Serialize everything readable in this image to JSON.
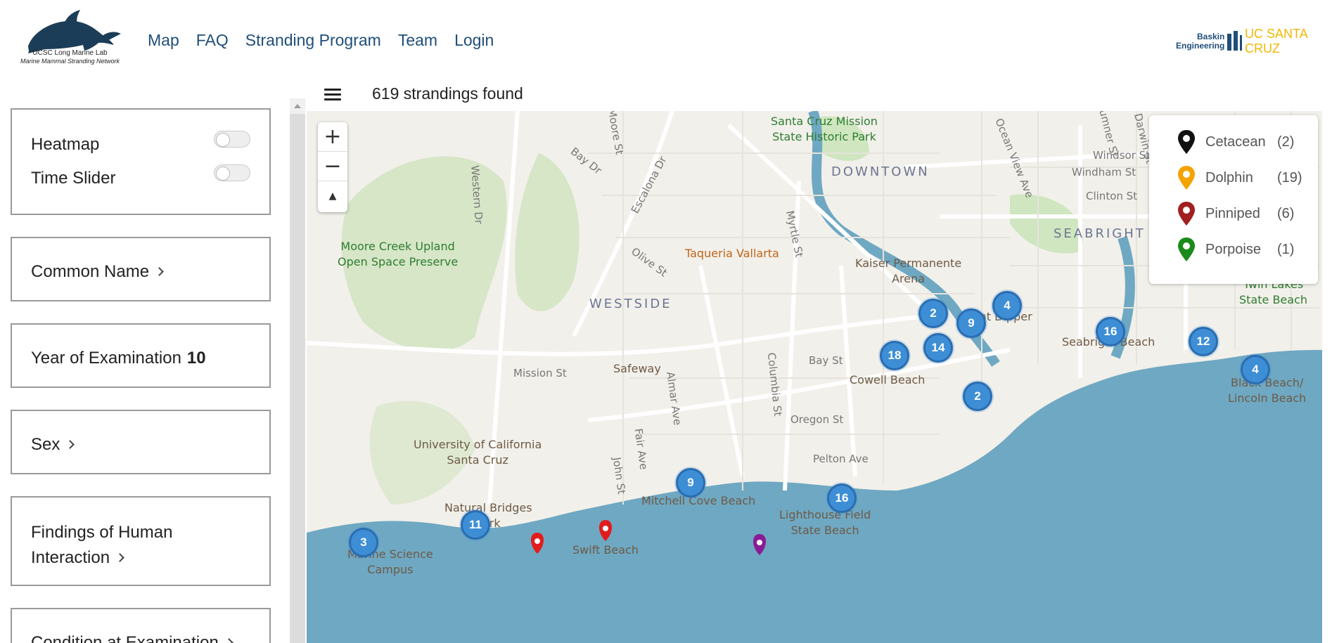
{
  "header": {
    "logo_line1": "UCSC Long Marine Lab",
    "logo_line2": "Marine Mammal Stranding Network",
    "nav": [
      "Map",
      "FAQ",
      "Stranding Program",
      "Team",
      "Login"
    ],
    "brand_baskin_line1": "Baskin",
    "brand_baskin_line2": "Engineering",
    "brand_ucsc": "UC SANTA CRUZ"
  },
  "toolbar": {
    "count_text": "619 strandings found"
  },
  "sidebar": {
    "heatmap_label": "Heatmap",
    "time_slider_label": "Time Slider",
    "common_name_label": "Common Name",
    "year_label": "Year of Examination",
    "year_count": "10",
    "sex_label": "Sex",
    "findings_label_line1": "Findings of Human",
    "findings_label_line2": "Interaction",
    "condition_label": "Condition at Examination"
  },
  "map": {
    "zoom_in": "+",
    "zoom_out": "−",
    "reset": "▲",
    "legend": [
      {
        "name": "Cetacean",
        "count": "(2)",
        "color": "#111111"
      },
      {
        "name": "Dolphin",
        "count": "(19)",
        "color": "#f5a300"
      },
      {
        "name": "Pinniped",
        "count": "(6)",
        "color": "#a11f1f"
      },
      {
        "name": "Porpoise",
        "count": "(1)",
        "color": "#1b8a1b"
      }
    ],
    "clusters": [
      "3",
      "11",
      "9",
      "16",
      "18",
      "2",
      "14",
      "9",
      "4",
      "2",
      "16",
      "12",
      "4"
    ],
    "labels": {
      "mission": "Santa Cruz Mission",
      "mission2": "State Historic Park",
      "downtown": "DOWNTOWN",
      "seabright": "SEABRIGHT",
      "westside": "WESTSIDE",
      "moore1": "Moore Creek Upland",
      "moore2": "Open Space Preserve",
      "taqueria": "Taqueria Vallarta",
      "kaiser1": "Kaiser Permanente",
      "kaiser2": "Arena",
      "safeway": "Safeway",
      "ucsc1": "University of California",
      "ucsc2": "Santa Cruz",
      "nb1": "Natural Bridges",
      "nb2": "Park",
      "marine1": "Marine Science",
      "marine2": "Campus",
      "swift": "Swift Beach",
      "mitchell": "Mitchell Cove Beach",
      "lighthouse1": "Lighthouse Field",
      "lighthouse2": "State Beach",
      "cowell": "Cowell Beach",
      "giant": "Giant Dipper",
      "seabright_beach": "Seabright Beach",
      "twin1": "Twin Lakes",
      "twin2": "State Beach",
      "black1": "Black Beach/",
      "black2": "Lincoln Beach",
      "mission_st": "Mission St",
      "bay_st": "Bay St",
      "bay_dr": "Bay Dr",
      "moore_st": "Moore St",
      "western_dr": "Western Dr",
      "escalona": "Escalona Dr",
      "olive": "Olive St",
      "myrtle": "Myrtle St",
      "ocean_view": "Ocean View Ave",
      "windsor": "Windsor St",
      "windham": "Windham St",
      "clinton": "Clinton St",
      "darwin": "Darwin St",
      "sumner": "Sumner St",
      "almar": "Almar Ave",
      "fair": "Fair Ave",
      "john": "John St",
      "columbia": "Columbia St",
      "oregon": "Oregon St",
      "pelton": "Pelton Ave"
    }
  }
}
